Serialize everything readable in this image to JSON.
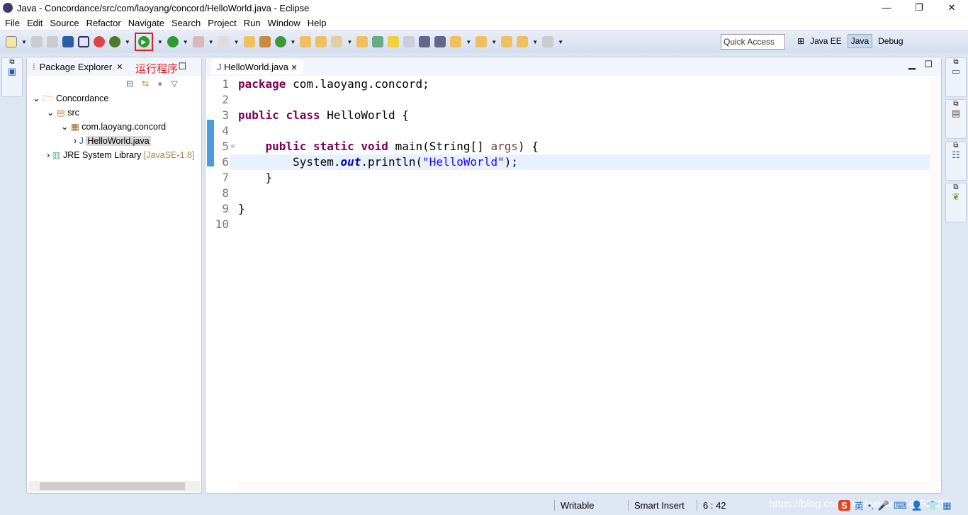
{
  "window": {
    "title": "Java - Concordance/src/com/laoyang/concord/HelloWorld.java - Eclipse",
    "minimize": "—",
    "maximize": "❐",
    "close": "✕"
  },
  "menu": [
    "File",
    "Edit",
    "Source",
    "Refactor",
    "Navigate",
    "Search",
    "Project",
    "Run",
    "Window",
    "Help"
  ],
  "toolbar": {
    "quick_access": "Quick Access",
    "run_annotation": "运行程序",
    "perspectives": [
      "Java EE",
      "Java",
      "Debug"
    ],
    "active_perspective": "Java",
    "highlight_color": "#e02020"
  },
  "package_explorer": {
    "title": "Package Explorer",
    "tree": [
      {
        "label": "Concordance",
        "level": 0
      },
      {
        "label": "src",
        "level": 1
      },
      {
        "label": "com.laoyang.concord",
        "level": 2
      },
      {
        "label": "HelloWorld.java",
        "level": 3,
        "selected": true
      },
      {
        "label": "JRE System Library",
        "suffix": "[JavaSE-1.8]",
        "level": 1
      }
    ]
  },
  "editor": {
    "tab": "HelloWorld.java",
    "lines": [
      "1",
      "2",
      "3",
      "4",
      "5",
      "6",
      "7",
      "8",
      "9",
      "10"
    ],
    "current_line": 6
  },
  "status": {
    "writable": "Writable",
    "insert_mode": "Smart Insert",
    "position": "6 : 42"
  },
  "watermark": "https://blog.csdn.net/weixin_44552039",
  "ime": {
    "logo": "S",
    "lang": "英",
    "punct": "•,"
  }
}
